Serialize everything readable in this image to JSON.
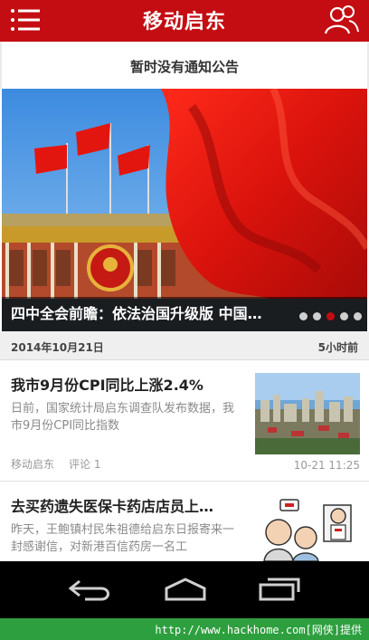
{
  "app": {
    "title": "移动启东",
    "menu_icon": "hamburger-menu-icon",
    "user_icon": "user-group-icon",
    "accent_color": "#c40d12"
  },
  "notice": {
    "text": "暂时没有通知公告"
  },
  "carousel": {
    "caption": "四中全会前瞻：依法治国升级版 中国…",
    "total_slides": 5,
    "active_index": 3
  },
  "date_bar": {
    "date": "2014年10月21日",
    "relative_time": "5小时前"
  },
  "news": [
    {
      "title": "我市9月份CPI同比上涨2.4%",
      "summary": "日前，国家统计局启东调查队发布数据，我市9月份CPI同比指数",
      "source": "移动启东",
      "comments": "评论 1",
      "time": "10-21 11:25"
    },
    {
      "title": "去买药遗失医保卡药店店员上…",
      "summary": "昨天，王鲍镇村民朱祖德给启东日报寄来一封感谢信，对新港百信药房一名工"
    }
  ],
  "system_nav": {
    "back_icon": "back-icon",
    "home_icon": "home-icon",
    "recents_icon": "recent-apps-icon"
  },
  "watermark": {
    "text": "http://www.hackhome.com[网侠]提供"
  }
}
